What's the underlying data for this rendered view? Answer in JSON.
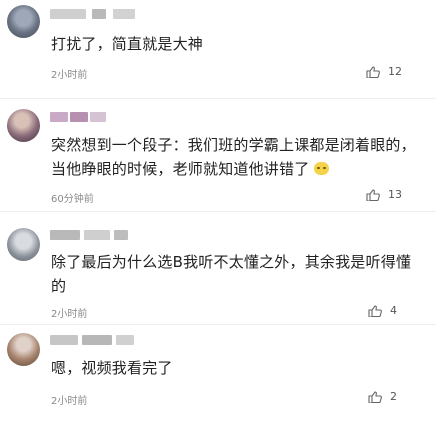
{
  "comments": [
    {
      "text": "打扰了，简直就是大神",
      "time": "2小时前",
      "likes": "12"
    },
    {
      "text": "突然想到一个段子：我们班的学霸上课都是闭着眼的，当他睁眼的时候，老师就知道他讲错了",
      "time": "60分钟前",
      "likes": "13"
    },
    {
      "text": "除了最后为什么选B我听不太懂之外，其余我是听得懂的",
      "time": "2小时前",
      "likes": "4"
    },
    {
      "text": "嗯，视频我看完了",
      "time": "2小时前",
      "likes": "2"
    }
  ],
  "icons": {
    "like": "thumbs-up-icon",
    "emoji": "laugh-emoji-icon"
  }
}
